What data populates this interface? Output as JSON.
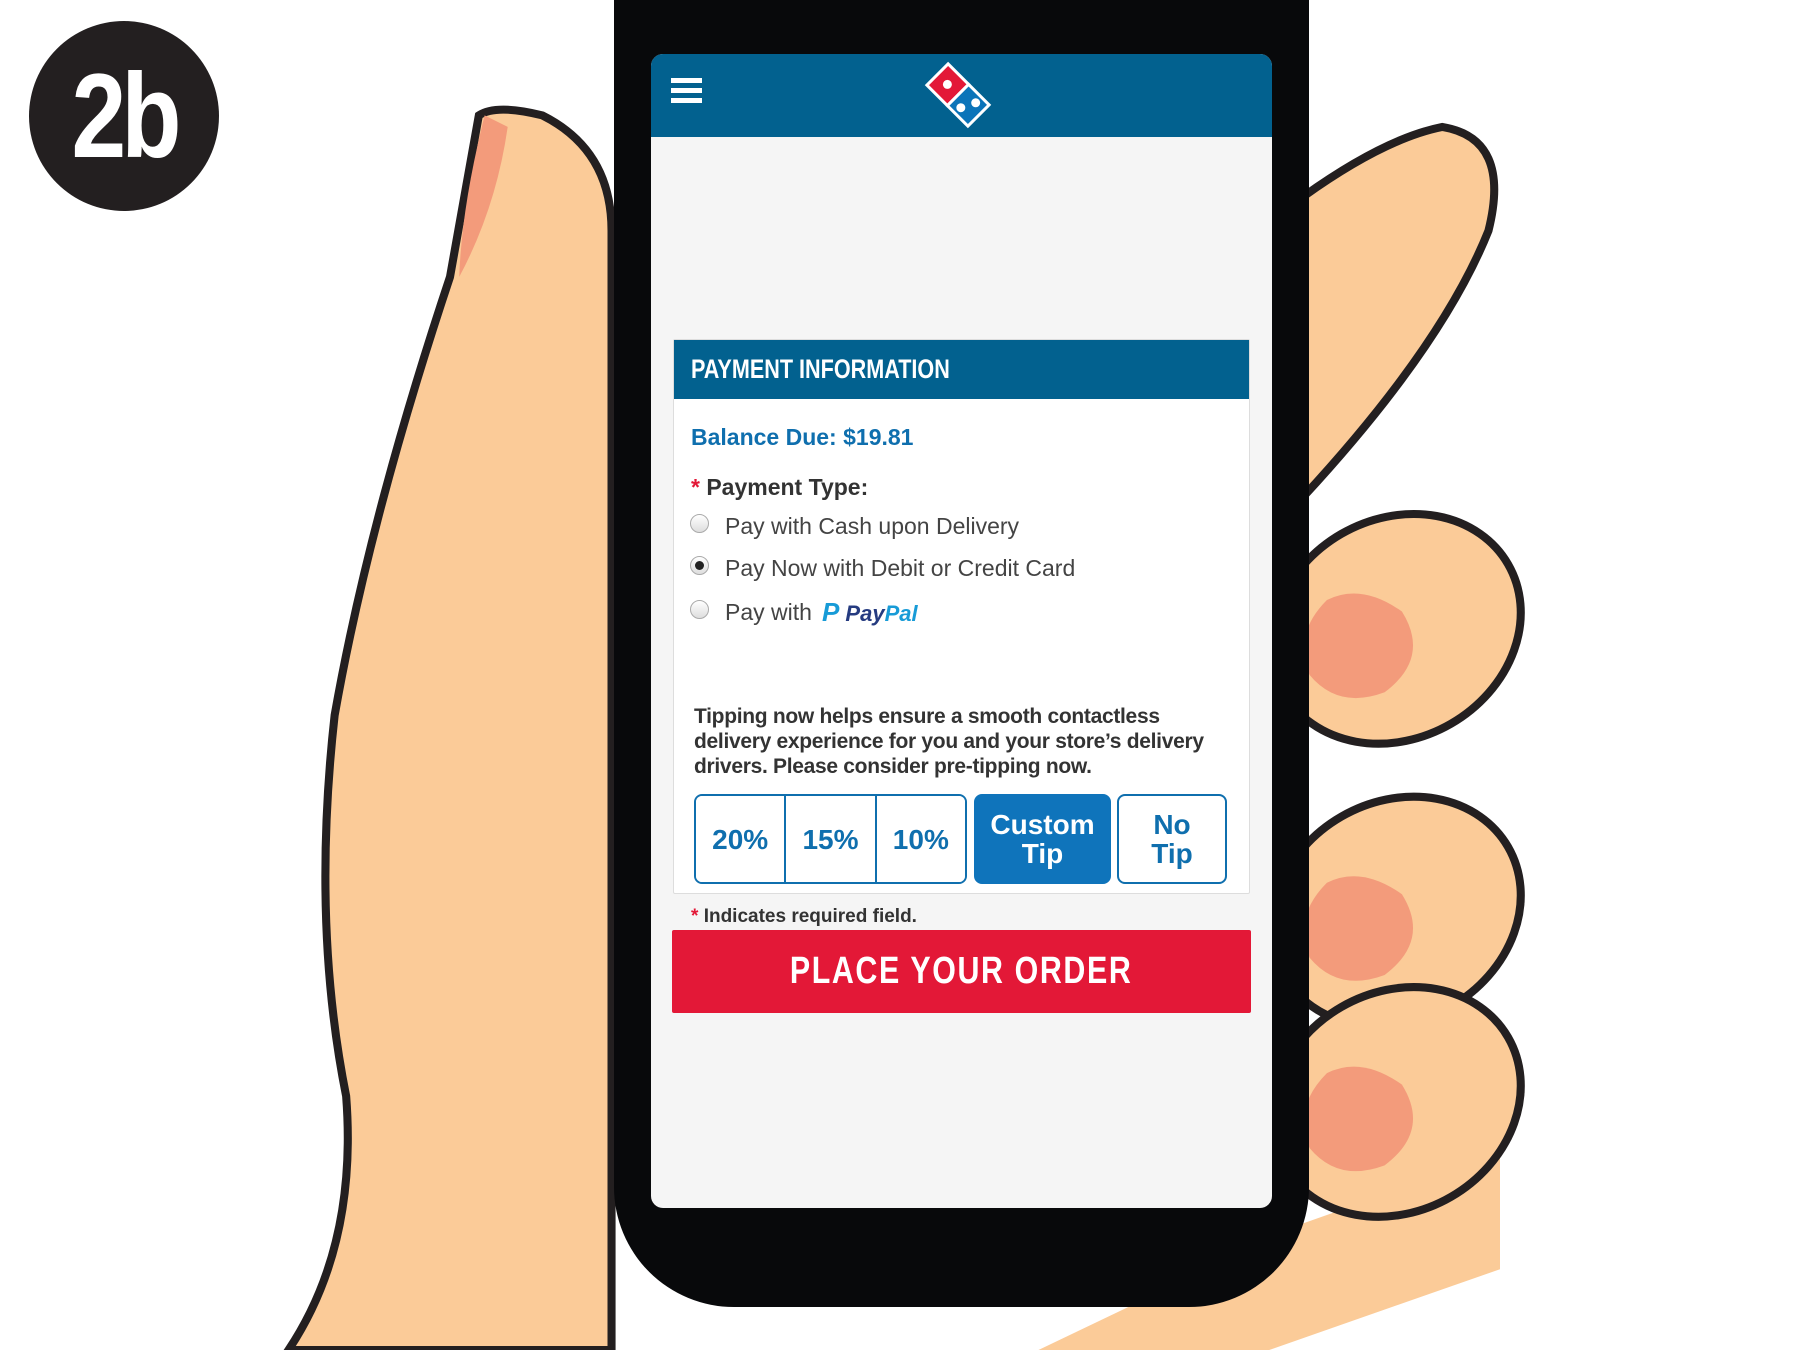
{
  "badge": {
    "label": "2b"
  },
  "colors": {
    "brand_blue": "#02618f",
    "accent_blue": "#0f6fae",
    "red": "#e31837",
    "skin": "#fbcb98"
  },
  "header": {
    "menu_icon": "hamburger-icon",
    "logo": "dominos-logo-icon"
  },
  "payment": {
    "title": "PAYMENT INFORMATION",
    "balance_due": "Balance Due: $19.81",
    "required_mark": "*",
    "payment_type_label": "Payment Type:",
    "options": [
      {
        "label": "Pay with Cash upon Delivery",
        "selected": false
      },
      {
        "label": "Pay Now with Debit or Credit Card",
        "selected": true
      },
      {
        "label": "Pay with",
        "brand_a": "Pay",
        "brand_b": "Pal",
        "selected": false
      }
    ],
    "tip_message": "Tipping now helps ensure a smooth contactless delivery experience for you and your store’s delivery drivers. Please consider pre-tipping now.",
    "tips": [
      {
        "label": "20%"
      },
      {
        "label": "15%"
      },
      {
        "label": "10%"
      }
    ],
    "custom_tip": {
      "line1": "Custom",
      "line2": "Tip",
      "selected": true
    },
    "no_tip": {
      "line1": "No",
      "line2": "Tip"
    },
    "required_note": "Indicates required field."
  },
  "place_order": "PLACE YOUR ORDER"
}
